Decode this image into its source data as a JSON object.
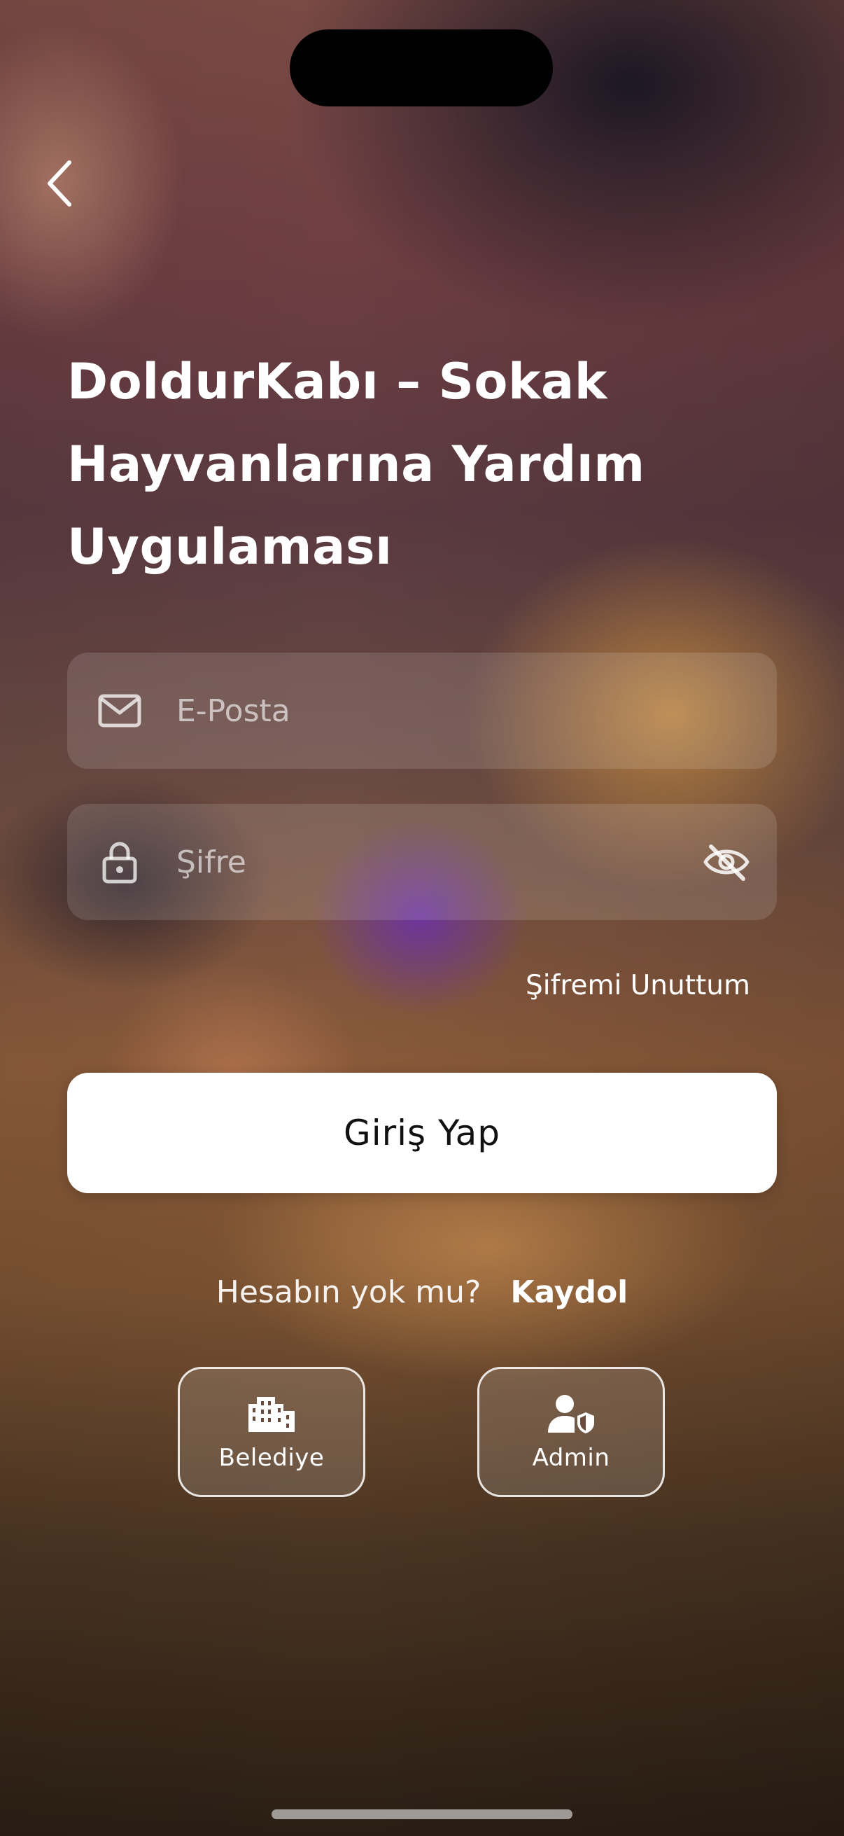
{
  "app": {
    "title": "DoldurKabı – Sokak Hayvanlarına Yardım Uygulaması"
  },
  "login_form": {
    "email": {
      "placeholder": "E-Posta",
      "value": "",
      "icon": "mail-icon"
    },
    "password": {
      "placeholder": "Şifre",
      "value": "",
      "icon": "lock-icon",
      "toggle_icon": "eye-off-icon"
    },
    "forgot_password_label": "Şifremi Unuttum",
    "submit_label": "Giriş Yap"
  },
  "signup": {
    "prompt": "Hesabın yok mu?",
    "link_label": "Kaydol"
  },
  "roles": [
    {
      "label": "Belediye",
      "icon": "building-icon"
    },
    {
      "label": "Admin",
      "icon": "user-shield-icon"
    }
  ],
  "colors": {
    "primary_button_bg": "#ffffff",
    "primary_button_text": "#111111",
    "text": "#ffffff"
  }
}
